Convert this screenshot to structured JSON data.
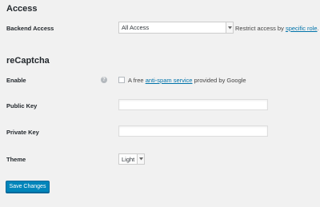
{
  "access": {
    "title": "Access",
    "backend_label": "Backend Access",
    "backend_value": "All Access",
    "backend_desc_prefix": "Restrict access by ",
    "backend_desc_link": "specific role",
    "backend_desc_suffix": "."
  },
  "recaptcha": {
    "title": "reCaptcha",
    "enable_label": "Enable",
    "help_icon": "question-mark-icon",
    "enable_desc_prefix": "A free ",
    "enable_desc_link": "anti-spam service",
    "enable_desc_suffix": " provided by Google",
    "public_key_label": "Public Key",
    "public_key_value": "",
    "private_key_label": "Private Key",
    "private_key_value": "",
    "theme_label": "Theme",
    "theme_value": "Light"
  },
  "actions": {
    "save_label": "Save Changes"
  },
  "colors": {
    "primary": "#0085ba",
    "link": "#0073aa",
    "background": "#f1f1f1"
  }
}
